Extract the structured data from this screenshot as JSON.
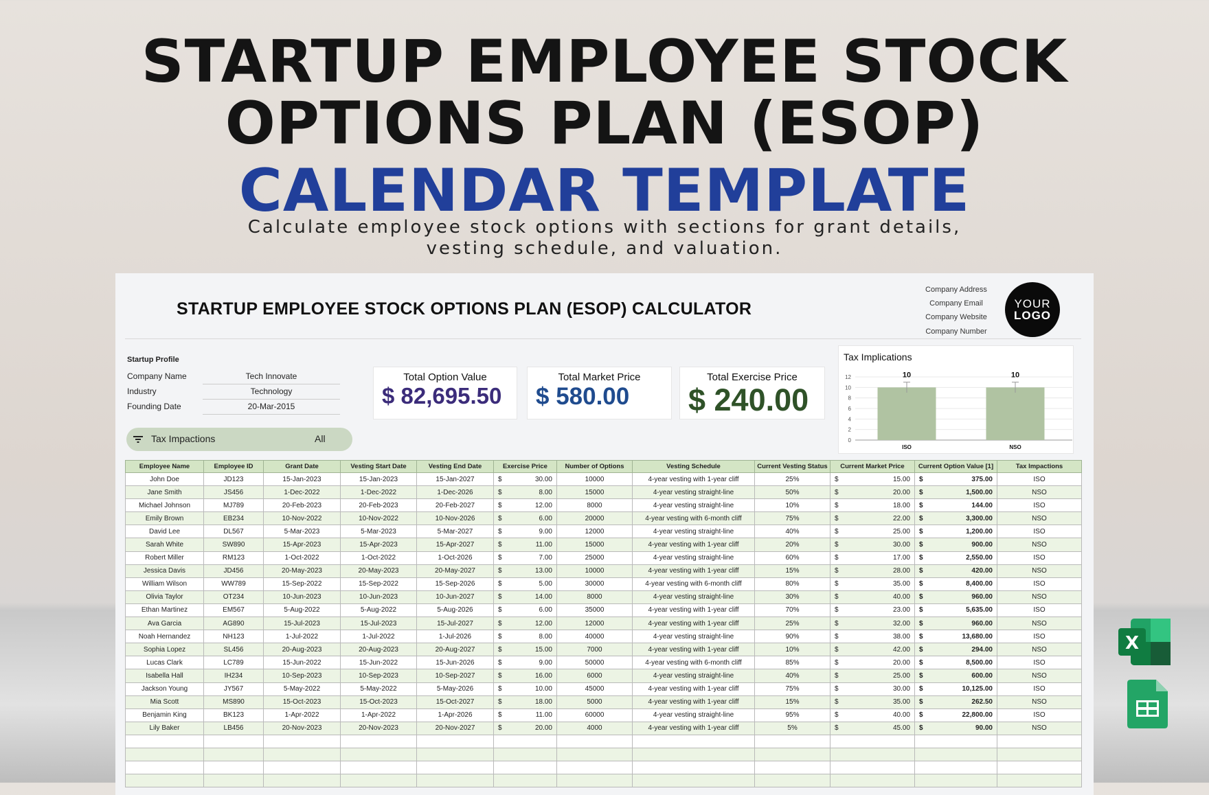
{
  "hero": {
    "line1": "STARTUP EMPLOYEE STOCK",
    "line2": "OPTIONS PLAN (ESOP)",
    "line3": "CALENDAR TEMPLATE",
    "subtitle1": "Calculate employee stock options with sections for grant details,",
    "subtitle2": "vesting schedule, and valuation."
  },
  "sheet": {
    "title": "STARTUP EMPLOYEE STOCK OPTIONS PLAN (ESOP) CALCULATOR",
    "company_info": [
      "Company Address",
      "Company Email",
      "Company Website",
      "Company Number"
    ],
    "logo": {
      "line1": "YOUR",
      "line2": "LOGO"
    },
    "profile": {
      "heading": "Startup Profile",
      "rows": [
        {
          "label": "Company Name",
          "value": "Tech Innovate"
        },
        {
          "label": "Industry",
          "value": "Technology"
        },
        {
          "label": "Founding Date",
          "value": "20-Mar-2015"
        }
      ]
    },
    "filter": {
      "label": "Tax Impactions",
      "value": "All",
      "icon": "filter-icon"
    },
    "kpis": [
      {
        "label": "Total Option Value",
        "value": "$ 82,695.50",
        "color": "#3b2c7a"
      },
      {
        "label": "Total Market Price",
        "value": "$ 580.00",
        "color": "#1f4b8e"
      },
      {
        "label": "Total Exercise Price",
        "value": "$ 240.00",
        "color": "#2f5228"
      }
    ],
    "columns": [
      "Employee Name",
      "Employee ID",
      "Grant Date",
      "Vesting Start Date",
      "Vesting End Date",
      "Exercise Price",
      "Number of Options",
      "Vesting Schedule",
      "Current Vesting Status",
      "Current Market Price",
      "Current Option Value [1]",
      "Tax Impactions"
    ],
    "rows": [
      [
        "John Doe",
        "JD123",
        "15-Jan-2023",
        "15-Jan-2023",
        "15-Jan-2027",
        "30.00",
        "10000",
        "4-year vesting with 1-year cliff",
        "25%",
        "15.00",
        "375.00",
        "ISO"
      ],
      [
        "Jane Smith",
        "JS456",
        "1-Dec-2022",
        "1-Dec-2022",
        "1-Dec-2026",
        "8.00",
        "15000",
        "4-year vesting straight-line",
        "50%",
        "20.00",
        "1,500.00",
        "NSO"
      ],
      [
        "Michael Johnson",
        "MJ789",
        "20-Feb-2023",
        "20-Feb-2023",
        "20-Feb-2027",
        "12.00",
        "8000",
        "4-year vesting straight-line",
        "10%",
        "18.00",
        "144.00",
        "ISO"
      ],
      [
        "Emily Brown",
        "EB234",
        "10-Nov-2022",
        "10-Nov-2022",
        "10-Nov-2026",
        "6.00",
        "20000",
        "4-year vesting with 6-month cliff",
        "75%",
        "22.00",
        "3,300.00",
        "NSO"
      ],
      [
        "David Lee",
        "DL567",
        "5-Mar-2023",
        "5-Mar-2023",
        "5-Mar-2027",
        "9.00",
        "12000",
        "4-year vesting straight-line",
        "40%",
        "25.00",
        "1,200.00",
        "ISO"
      ],
      [
        "Sarah White",
        "SW890",
        "15-Apr-2023",
        "15-Apr-2023",
        "15-Apr-2027",
        "11.00",
        "15000",
        "4-year vesting with 1-year cliff",
        "20%",
        "30.00",
        "900.00",
        "NSO"
      ],
      [
        "Robert Miller",
        "RM123",
        "1-Oct-2022",
        "1-Oct-2022",
        "1-Oct-2026",
        "7.00",
        "25000",
        "4-year vesting straight-line",
        "60%",
        "17.00",
        "2,550.00",
        "ISO"
      ],
      [
        "Jessica Davis",
        "JD456",
        "20-May-2023",
        "20-May-2023",
        "20-May-2027",
        "13.00",
        "10000",
        "4-year vesting with 1-year cliff",
        "15%",
        "28.00",
        "420.00",
        "NSO"
      ],
      [
        "William Wilson",
        "WW789",
        "15-Sep-2022",
        "15-Sep-2022",
        "15-Sep-2026",
        "5.00",
        "30000",
        "4-year vesting with 6-month cliff",
        "80%",
        "35.00",
        "8,400.00",
        "ISO"
      ],
      [
        "Olivia Taylor",
        "OT234",
        "10-Jun-2023",
        "10-Jun-2023",
        "10-Jun-2027",
        "14.00",
        "8000",
        "4-year vesting straight-line",
        "30%",
        "40.00",
        "960.00",
        "NSO"
      ],
      [
        "Ethan Martinez",
        "EM567",
        "5-Aug-2022",
        "5-Aug-2022",
        "5-Aug-2026",
        "6.00",
        "35000",
        "4-year vesting with 1-year cliff",
        "70%",
        "23.00",
        "5,635.00",
        "ISO"
      ],
      [
        "Ava Garcia",
        "AG890",
        "15-Jul-2023",
        "15-Jul-2023",
        "15-Jul-2027",
        "12.00",
        "12000",
        "4-year vesting with 1-year cliff",
        "25%",
        "32.00",
        "960.00",
        "NSO"
      ],
      [
        "Noah Hernandez",
        "NH123",
        "1-Jul-2022",
        "1-Jul-2022",
        "1-Jul-2026",
        "8.00",
        "40000",
        "4-year vesting straight-line",
        "90%",
        "38.00",
        "13,680.00",
        "ISO"
      ],
      [
        "Sophia Lopez",
        "SL456",
        "20-Aug-2023",
        "20-Aug-2023",
        "20-Aug-2027",
        "15.00",
        "7000",
        "4-year vesting with 1-year cliff",
        "10%",
        "42.00",
        "294.00",
        "NSO"
      ],
      [
        "Lucas Clark",
        "LC789",
        "15-Jun-2022",
        "15-Jun-2022",
        "15-Jun-2026",
        "9.00",
        "50000",
        "4-year vesting with 6-month cliff",
        "85%",
        "20.00",
        "8,500.00",
        "ISO"
      ],
      [
        "Isabella Hall",
        "IH234",
        "10-Sep-2023",
        "10-Sep-2023",
        "10-Sep-2027",
        "16.00",
        "6000",
        "4-year vesting straight-line",
        "40%",
        "25.00",
        "600.00",
        "NSO"
      ],
      [
        "Jackson Young",
        "JY567",
        "5-May-2022",
        "5-May-2022",
        "5-May-2026",
        "10.00",
        "45000",
        "4-year vesting with 1-year cliff",
        "75%",
        "30.00",
        "10,125.00",
        "ISO"
      ],
      [
        "Mia Scott",
        "MS890",
        "15-Oct-2023",
        "15-Oct-2023",
        "15-Oct-2027",
        "18.00",
        "5000",
        "4-year vesting with 1-year cliff",
        "15%",
        "35.00",
        "262.50",
        "NSO"
      ],
      [
        "Benjamin King",
        "BK123",
        "1-Apr-2022",
        "1-Apr-2022",
        "1-Apr-2026",
        "11.00",
        "60000",
        "4-year vesting straight-line",
        "95%",
        "40.00",
        "22,800.00",
        "ISO"
      ],
      [
        "Lily Baker",
        "LB456",
        "20-Nov-2023",
        "20-Nov-2023",
        "20-Nov-2027",
        "20.00",
        "4000",
        "4-year vesting with 1-year cliff",
        "5%",
        "45.00",
        "90.00",
        "NSO"
      ]
    ],
    "currency_symbol": "$"
  },
  "chart_data": {
    "type": "bar",
    "title": "Tax Implications",
    "categories": [
      "ISO",
      "NSO"
    ],
    "values": [
      10,
      10
    ],
    "data_labels": [
      "10",
      "10"
    ],
    "ylim": [
      0,
      12
    ],
    "yticks": [
      0,
      2,
      4,
      6,
      8,
      10,
      12
    ],
    "error_bars": true,
    "grid": true,
    "bar_color": "#b0c3a2"
  },
  "app_icons": [
    "excel-icon",
    "google-sheets-icon"
  ]
}
